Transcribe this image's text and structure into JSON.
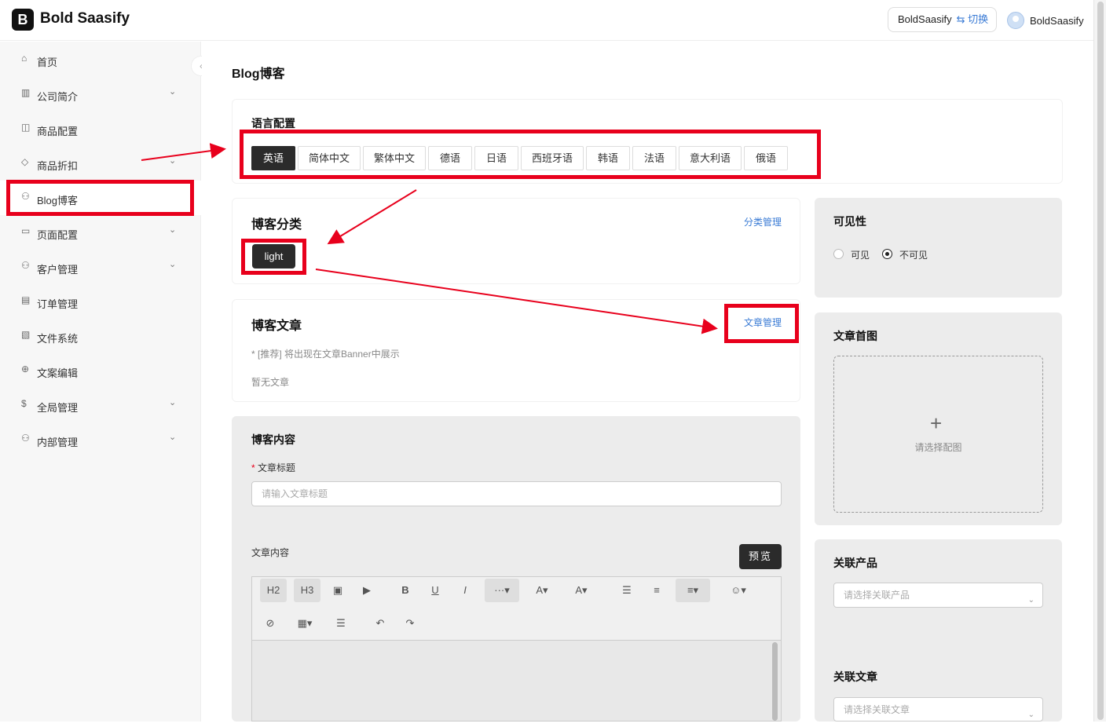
{
  "app": {
    "logo_mark": "B",
    "title": "Bold Saasify"
  },
  "header": {
    "org_name": "BoldSaasify",
    "switch_label": "⇆ 切换",
    "user_name": "BoldSaasify"
  },
  "sidebar": {
    "items": [
      {
        "label": "首页",
        "icon": "home-icon",
        "has_children": false
      },
      {
        "label": "公司简介",
        "icon": "building-icon",
        "has_children": true
      },
      {
        "label": "商品配置",
        "icon": "box-icon",
        "has_children": false
      },
      {
        "label": "商品折扣",
        "icon": "tag-icon",
        "has_children": true
      },
      {
        "label": "Blog博客",
        "icon": "users-icon",
        "has_children": false,
        "active": true
      },
      {
        "label": "页面配置",
        "icon": "monitor-icon",
        "has_children": true
      },
      {
        "label": "客户管理",
        "icon": "users-icon",
        "has_children": true
      },
      {
        "label": "订单管理",
        "icon": "file-icon",
        "has_children": false
      },
      {
        "label": "文件系统",
        "icon": "folder-icon",
        "has_children": false
      },
      {
        "label": "文案编辑",
        "icon": "globe-icon",
        "has_children": false
      },
      {
        "label": "全局管理",
        "icon": "dollar-icon",
        "has_children": true
      },
      {
        "label": "内部管理",
        "icon": "user-icon",
        "has_children": true
      }
    ]
  },
  "page": {
    "title": "Blog博客"
  },
  "language_config": {
    "title": "语言配置",
    "languages": [
      "英语",
      "简体中文",
      "繁体中文",
      "德语",
      "日语",
      "西班牙语",
      "韩语",
      "法语",
      "意大利语",
      "俄语"
    ],
    "selected": "英语"
  },
  "blog_category": {
    "title": "博客分类",
    "manage_link": "分类管理",
    "tags": [
      "light"
    ]
  },
  "blog_articles": {
    "title": "博客文章",
    "manage_link": "文章管理",
    "hint": "* [推荐] 将出现在文章Banner中展示",
    "empty": "暂无文章"
  },
  "blog_content": {
    "title": "博客内容",
    "article_title_label": "文章标题",
    "required_mark": "*",
    "article_title_placeholder": "请输入文章标题",
    "content_label": "文章内容",
    "preview_label": "预览",
    "toolbar": [
      "H2",
      "H3",
      "image-icon",
      "video-icon",
      "B",
      "U",
      "I",
      "···▾",
      "A▾",
      "A▾",
      "bullet-list-icon",
      "ordered-list-icon",
      "align-icon",
      "emoji-icon",
      "link-icon",
      "table-icon",
      "divider-icon",
      "undo-icon",
      "redo-icon"
    ]
  },
  "visibility": {
    "title": "可见性",
    "options": [
      "可见",
      "不可见"
    ],
    "selected": "不可见"
  },
  "cover_image": {
    "title": "文章首图",
    "upload_text": "请选择配图"
  },
  "related_products": {
    "title": "关联产品",
    "placeholder": "请选择关联产品"
  },
  "related_articles": {
    "title": "关联文章",
    "placeholder": "请选择关联文章"
  },
  "colors": {
    "accent_link": "#3a7bd5",
    "dark_button": "#2b2b2b",
    "annotation_red": "#e8001c"
  }
}
